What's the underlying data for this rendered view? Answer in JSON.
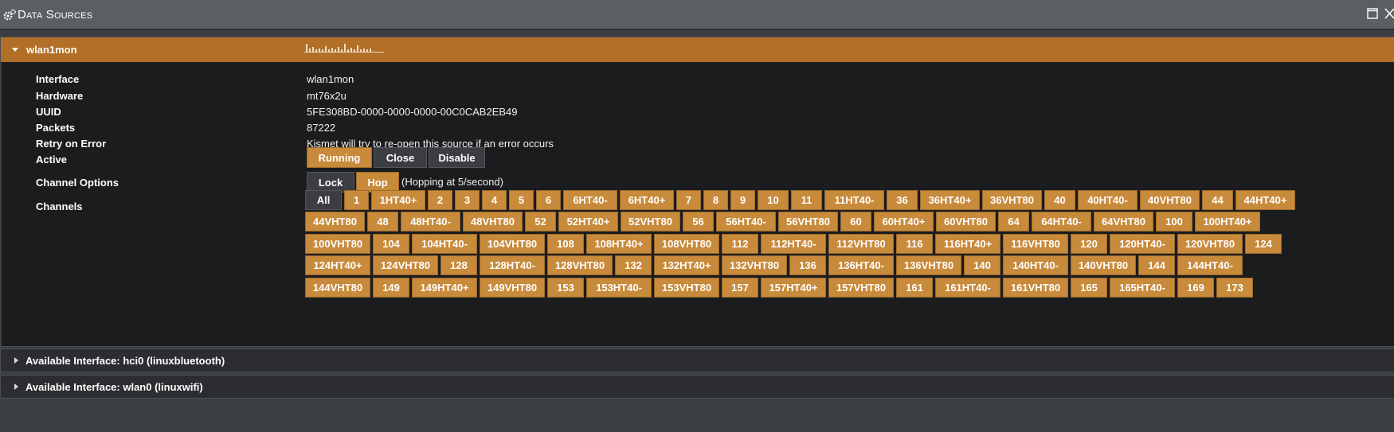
{
  "window": {
    "title": "Data Sources",
    "icons": [
      "gears-icon",
      "maximize-icon",
      "close-icon"
    ]
  },
  "source": {
    "name": "wlan1mon",
    "fields": {
      "interface_label": "Interface",
      "interface_value": "wlan1mon",
      "hardware_label": "Hardware",
      "hardware_value": "mt76x2u",
      "uuid_label": "UUID",
      "uuid_value": "5FE308BD-0000-0000-0000-00C0CAB2EB49",
      "packets_label": "Packets",
      "packets_value": "87222",
      "retry_label": "Retry on Error",
      "retry_value": "Kismet will try to re-open this source if an error occurs",
      "active_label": "Active",
      "channel_options_label": "Channel Options",
      "channels_label": "Channels"
    },
    "active_buttons": {
      "running": "Running",
      "close": "Close",
      "disable": "Disable"
    },
    "channel_option_buttons": {
      "lock": "Lock",
      "hop": "Hop",
      "hop_note": "(Hopping at 5/second)"
    },
    "channels_all": "All",
    "channels": [
      [
        "1",
        "1HT40+",
        "2",
        "3",
        "4",
        "5",
        "6",
        "6HT40-",
        "6HT40+",
        "7",
        "8",
        "9",
        "10",
        "11",
        "11HT40-",
        "36",
        "36HT40+",
        "36VHT80",
        "40",
        "40HT40-",
        "40VHT80",
        "44",
        "44HT40+"
      ],
      [
        "44VHT80",
        "48",
        "48HT40-",
        "48VHT80",
        "52",
        "52HT40+",
        "52VHT80",
        "56",
        "56HT40-",
        "56VHT80",
        "60",
        "60HT40+",
        "60VHT80",
        "64",
        "64HT40-",
        "64VHT80",
        "100",
        "100HT40+"
      ],
      [
        "100VHT80",
        "104",
        "104HT40-",
        "104VHT80",
        "108",
        "108HT40+",
        "108VHT80",
        "112",
        "112HT40-",
        "112VHT80",
        "116",
        "116HT40+",
        "116VHT80",
        "120",
        "120HT40-",
        "120VHT80",
        "124"
      ],
      [
        "124HT40+",
        "124VHT80",
        "128",
        "128HT40-",
        "128VHT80",
        "132",
        "132HT40+",
        "132VHT80",
        "136",
        "136HT40-",
        "136VHT80",
        "140",
        "140HT40-",
        "140VHT80",
        "144",
        "144HT40-"
      ],
      [
        "144VHT80",
        "149",
        "149HT40+",
        "149VHT80",
        "153",
        "153HT40-",
        "153VHT80",
        "157",
        "157HT40+",
        "157VHT80",
        "161",
        "161HT40-",
        "161VHT80",
        "165",
        "165HT40-",
        "169",
        "173"
      ]
    ]
  },
  "available": [
    {
      "label": "Available Interface: hci0 (linuxbluetooth)"
    },
    {
      "label": "Available Interface: wlan0 (linuxwifi)"
    }
  ],
  "colors": {
    "accent": "#b26f27",
    "button_on": "#c88a3b",
    "button_off": "#3b3d40"
  }
}
